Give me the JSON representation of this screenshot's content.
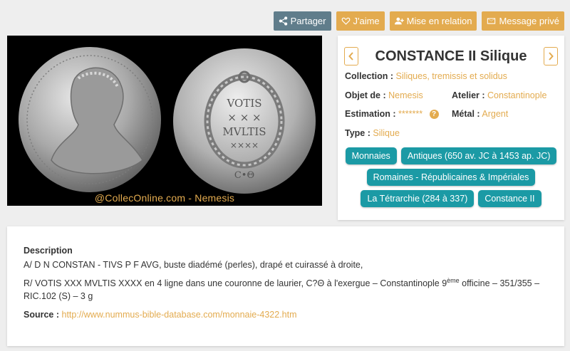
{
  "actions": {
    "share": "Partager",
    "like": "J'aime",
    "connect": "Mise en relation",
    "message": "Message privé"
  },
  "photo": {
    "watermark": "@CollecOnline.com - Nemesis"
  },
  "item": {
    "title": "CONSTANCE II Silique",
    "collection_label": "Collection :",
    "collection_value": "Siliques, tremissis et solidus",
    "owner_label": "Objet de :",
    "owner_value": "Nemesis",
    "workshop_label": "Atelier :",
    "workshop_value": "Constantinople",
    "estimate_label": "Estimation :",
    "estimate_value": "*******",
    "metal_label": "Métal :",
    "metal_value": "Argent",
    "type_label": "Type :",
    "type_value": "Silique",
    "tags": [
      "Monnaies",
      "Antiques (650 av. JC à 1453 ap. JC)",
      "Romaines - Républicaines & Impériales",
      "La Tétrarchie (284 à 337)",
      "Constance II"
    ]
  },
  "description": {
    "heading": "Description",
    "line1": "A/ D N CONSTAN - TIVS P F AVG, buste diadémé (perles), drapé et cuirassé à droite,",
    "line2_part1": "R/ VOTIS XXX MVLTIS XXXX en 4 ligne dans une couronne de laurier, C?Θ à l'exergue – Constantinople 9",
    "line2_sup": "ème",
    "line2_part2": " officine – 351/355 – RIC.102 (S) – 3 g",
    "source_label": "Source :",
    "source_url": "http://www.nummus-bible-database.com/monnaie-4322.htm"
  },
  "colors": {
    "accent": "#e3ab4f",
    "share_button": "#607d8b",
    "tag": "#1b9aa5"
  }
}
